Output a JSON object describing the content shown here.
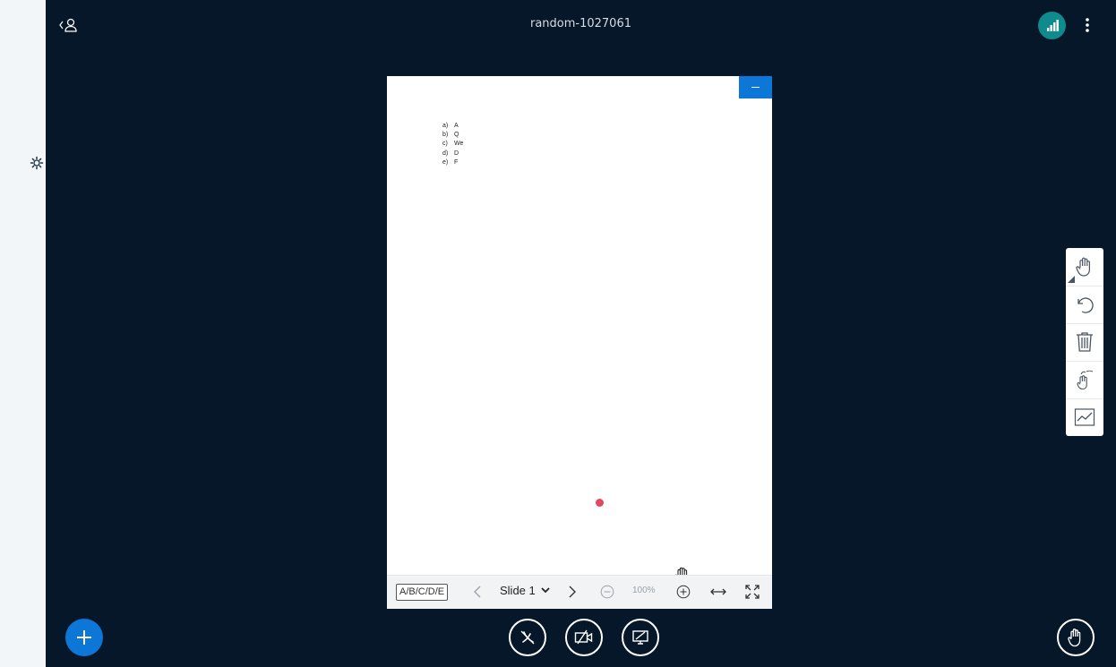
{
  "meeting": {
    "title": "random-1027061"
  },
  "presentation": {
    "options": [
      {
        "letter": "a)",
        "text": "A"
      },
      {
        "letter": "b)",
        "text": "Q"
      },
      {
        "letter": "c)",
        "text": "We"
      },
      {
        "letter": "d)",
        "text": "D"
      },
      {
        "letter": "e)",
        "text": "F"
      }
    ],
    "toolbar": {
      "quick_poll_label": "A/B/C/D/E",
      "slide_label": "Slide 1",
      "zoom_label": "100%"
    }
  },
  "colors": {
    "background": "#06172a",
    "accent": "#0c77d6",
    "connection": "#0f8b8d",
    "pointer": "#e04a5f"
  },
  "icons": {
    "users_toggle": "user-list-icon",
    "settings": "gear-icon",
    "connection": "signal-bars-icon",
    "options": "vertical-dots-icon",
    "whiteboard_tools": [
      "hand-icon",
      "undo-icon",
      "trash-icon",
      "multi-user-hand-icon",
      "line-chart-icon"
    ],
    "actions": "plus-icon",
    "audio": "mic-off-icon",
    "video": "video-off-icon",
    "screenshare": "screenshare-off-icon",
    "raise_hand": "raise-hand-icon"
  }
}
